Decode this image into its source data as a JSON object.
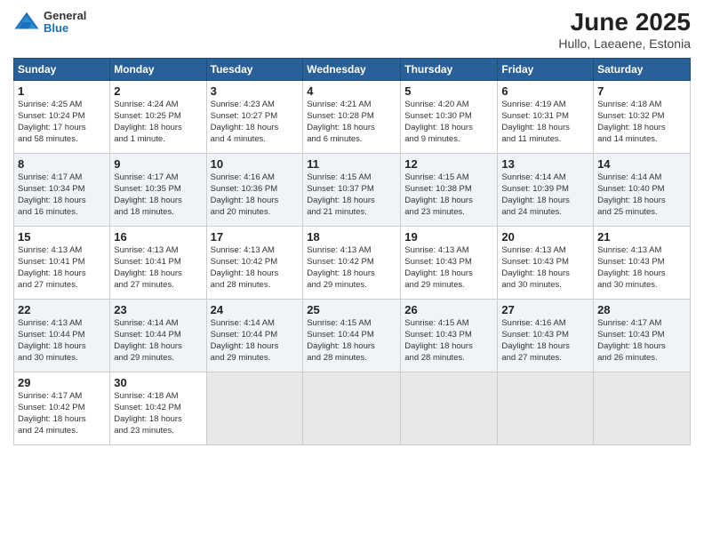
{
  "logo": {
    "general": "General",
    "blue": "Blue"
  },
  "title": "June 2025",
  "subtitle": "Hullo, Laeaene, Estonia",
  "weekdays": [
    "Sunday",
    "Monday",
    "Tuesday",
    "Wednesday",
    "Thursday",
    "Friday",
    "Saturday"
  ],
  "weeks": [
    [
      {
        "day": "1",
        "info": "Sunrise: 4:25 AM\nSunset: 10:24 PM\nDaylight: 17 hours\nand 58 minutes."
      },
      {
        "day": "2",
        "info": "Sunrise: 4:24 AM\nSunset: 10:25 PM\nDaylight: 18 hours\nand 1 minute."
      },
      {
        "day": "3",
        "info": "Sunrise: 4:23 AM\nSunset: 10:27 PM\nDaylight: 18 hours\nand 4 minutes."
      },
      {
        "day": "4",
        "info": "Sunrise: 4:21 AM\nSunset: 10:28 PM\nDaylight: 18 hours\nand 6 minutes."
      },
      {
        "day": "5",
        "info": "Sunrise: 4:20 AM\nSunset: 10:30 PM\nDaylight: 18 hours\nand 9 minutes."
      },
      {
        "day": "6",
        "info": "Sunrise: 4:19 AM\nSunset: 10:31 PM\nDaylight: 18 hours\nand 11 minutes."
      },
      {
        "day": "7",
        "info": "Sunrise: 4:18 AM\nSunset: 10:32 PM\nDaylight: 18 hours\nand 14 minutes."
      }
    ],
    [
      {
        "day": "8",
        "info": "Sunrise: 4:17 AM\nSunset: 10:34 PM\nDaylight: 18 hours\nand 16 minutes."
      },
      {
        "day": "9",
        "info": "Sunrise: 4:17 AM\nSunset: 10:35 PM\nDaylight: 18 hours\nand 18 minutes."
      },
      {
        "day": "10",
        "info": "Sunrise: 4:16 AM\nSunset: 10:36 PM\nDaylight: 18 hours\nand 20 minutes."
      },
      {
        "day": "11",
        "info": "Sunrise: 4:15 AM\nSunset: 10:37 PM\nDaylight: 18 hours\nand 21 minutes."
      },
      {
        "day": "12",
        "info": "Sunrise: 4:15 AM\nSunset: 10:38 PM\nDaylight: 18 hours\nand 23 minutes."
      },
      {
        "day": "13",
        "info": "Sunrise: 4:14 AM\nSunset: 10:39 PM\nDaylight: 18 hours\nand 24 minutes."
      },
      {
        "day": "14",
        "info": "Sunrise: 4:14 AM\nSunset: 10:40 PM\nDaylight: 18 hours\nand 25 minutes."
      }
    ],
    [
      {
        "day": "15",
        "info": "Sunrise: 4:13 AM\nSunset: 10:41 PM\nDaylight: 18 hours\nand 27 minutes."
      },
      {
        "day": "16",
        "info": "Sunrise: 4:13 AM\nSunset: 10:41 PM\nDaylight: 18 hours\nand 27 minutes."
      },
      {
        "day": "17",
        "info": "Sunrise: 4:13 AM\nSunset: 10:42 PM\nDaylight: 18 hours\nand 28 minutes."
      },
      {
        "day": "18",
        "info": "Sunrise: 4:13 AM\nSunset: 10:42 PM\nDaylight: 18 hours\nand 29 minutes."
      },
      {
        "day": "19",
        "info": "Sunrise: 4:13 AM\nSunset: 10:43 PM\nDaylight: 18 hours\nand 29 minutes."
      },
      {
        "day": "20",
        "info": "Sunrise: 4:13 AM\nSunset: 10:43 PM\nDaylight: 18 hours\nand 30 minutes."
      },
      {
        "day": "21",
        "info": "Sunrise: 4:13 AM\nSunset: 10:43 PM\nDaylight: 18 hours\nand 30 minutes."
      }
    ],
    [
      {
        "day": "22",
        "info": "Sunrise: 4:13 AM\nSunset: 10:44 PM\nDaylight: 18 hours\nand 30 minutes."
      },
      {
        "day": "23",
        "info": "Sunrise: 4:14 AM\nSunset: 10:44 PM\nDaylight: 18 hours\nand 29 minutes."
      },
      {
        "day": "24",
        "info": "Sunrise: 4:14 AM\nSunset: 10:44 PM\nDaylight: 18 hours\nand 29 minutes."
      },
      {
        "day": "25",
        "info": "Sunrise: 4:15 AM\nSunset: 10:44 PM\nDaylight: 18 hours\nand 28 minutes."
      },
      {
        "day": "26",
        "info": "Sunrise: 4:15 AM\nSunset: 10:43 PM\nDaylight: 18 hours\nand 28 minutes."
      },
      {
        "day": "27",
        "info": "Sunrise: 4:16 AM\nSunset: 10:43 PM\nDaylight: 18 hours\nand 27 minutes."
      },
      {
        "day": "28",
        "info": "Sunrise: 4:17 AM\nSunset: 10:43 PM\nDaylight: 18 hours\nand 26 minutes."
      }
    ],
    [
      {
        "day": "29",
        "info": "Sunrise: 4:17 AM\nSunset: 10:42 PM\nDaylight: 18 hours\nand 24 minutes."
      },
      {
        "day": "30",
        "info": "Sunrise: 4:18 AM\nSunset: 10:42 PM\nDaylight: 18 hours\nand 23 minutes."
      },
      {
        "day": "",
        "info": ""
      },
      {
        "day": "",
        "info": ""
      },
      {
        "day": "",
        "info": ""
      },
      {
        "day": "",
        "info": ""
      },
      {
        "day": "",
        "info": ""
      }
    ]
  ]
}
